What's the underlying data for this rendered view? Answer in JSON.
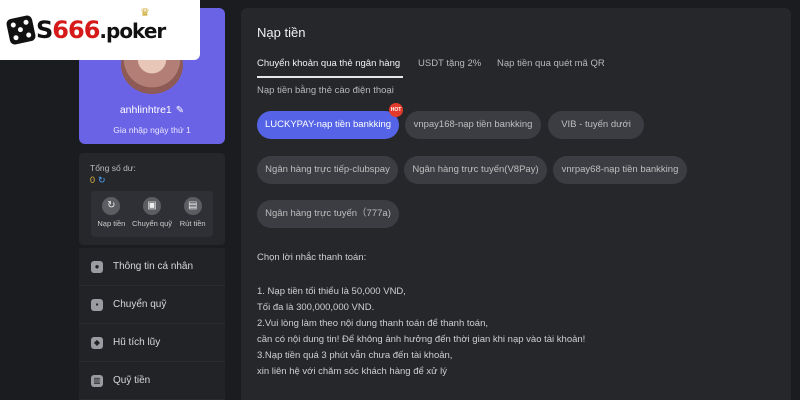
{
  "logo": {
    "brand_a": "S",
    "brand_num": "666",
    "brand_suffix": ".poker"
  },
  "profile": {
    "username": "anhlinhtre1",
    "joined": "Gia nhập ngày thứ 1"
  },
  "balance": {
    "label": "Tổng số dư:",
    "value": "0",
    "actions": [
      {
        "label": "Nạp tiền",
        "icon": "deposit-icon"
      },
      {
        "label": "Chuyển quỹ",
        "icon": "wallet-icon"
      },
      {
        "label": "Rút tiền",
        "icon": "withdraw-icon"
      }
    ]
  },
  "menu": [
    {
      "label": "Thông tin cá nhân",
      "icon": "user-icon"
    },
    {
      "label": "Chuyển quỹ",
      "icon": "wallet-icon"
    },
    {
      "label": "Hũ tích lũy",
      "icon": "jar-icon"
    },
    {
      "label": "Quỹ tiền",
      "icon": "fund-icon"
    }
  ],
  "main": {
    "title": "Nạp tiền",
    "tabs": [
      "Chuyển khoản qua thẻ ngân hàng",
      "USDT tặng 2%",
      "Nạp tiền qua quét mã QR",
      "Nạp tiền bằng thẻ cào điện thoại"
    ],
    "methods": [
      "LUCKYPAY-nạp tiền bankking",
      "vnpay168-nạp tiền bankking",
      "VIB - tuyến dưới",
      "Ngân hàng trực tiếp-clubspay",
      "Ngân hàng trực tuyến(V8Pay)",
      "vnrpay68-nạp tiền bankking",
      "Ngân hàng trực tuyến（777a)"
    ],
    "hot_badge": "HOT",
    "prompt": "Chọn lời nhắc thanh toán:",
    "notes": [
      "1. Nạp tiền tối thiểu là 50,000 VND,",
      "Tối đa là 300,000,000 VND.",
      "2.Vui lòng làm theo nội dung thanh toán để thanh toán,",
      "cần có nội dung tin! Để không ảnh hưởng đến thời gian khi nạp  vào tài khoản!",
      "3.Nạp tiền quá 3 phút vẫn chưa đến tài khoản,",
      "xin liên hệ với chăm sóc khách hàng để xử lý"
    ]
  }
}
